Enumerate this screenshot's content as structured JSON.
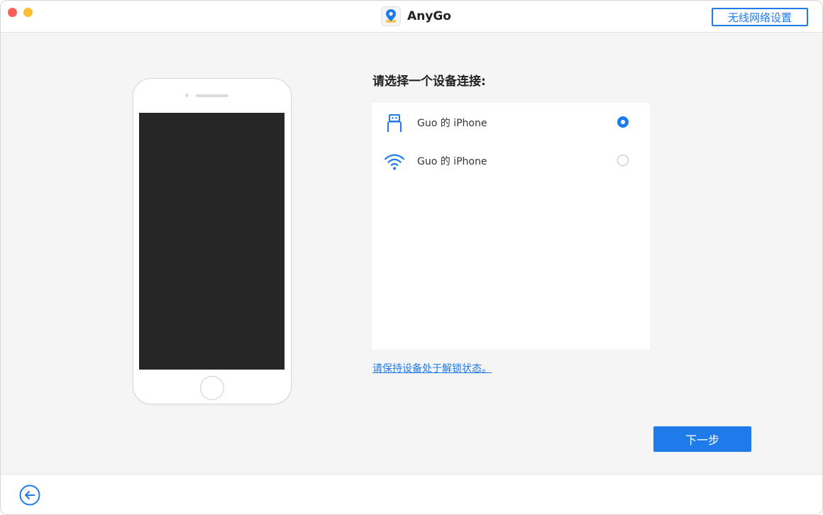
{
  "window": {
    "app_name": "AnyGo",
    "logo_icon": "map-pin-icon"
  },
  "header": {
    "wifi_settings_label": "无线网络设置"
  },
  "main": {
    "prompt": "请选择一个设备连接:",
    "devices": [
      {
        "name": "Guo 的 iPhone",
        "connection": "usb",
        "icon": "usb-cable-icon",
        "selected": true
      },
      {
        "name": "Guo 的 iPhone",
        "connection": "wifi",
        "icon": "wifi-icon",
        "selected": false
      }
    ],
    "unlock_hint": "请保持设备处于解锁状态。",
    "next_label": "下一步"
  },
  "footer": {
    "back_icon": "arrow-left-circle-icon"
  },
  "colors": {
    "accent": "#1f7aea",
    "phone_screen": "#262626",
    "background": "#f5f5f5"
  }
}
